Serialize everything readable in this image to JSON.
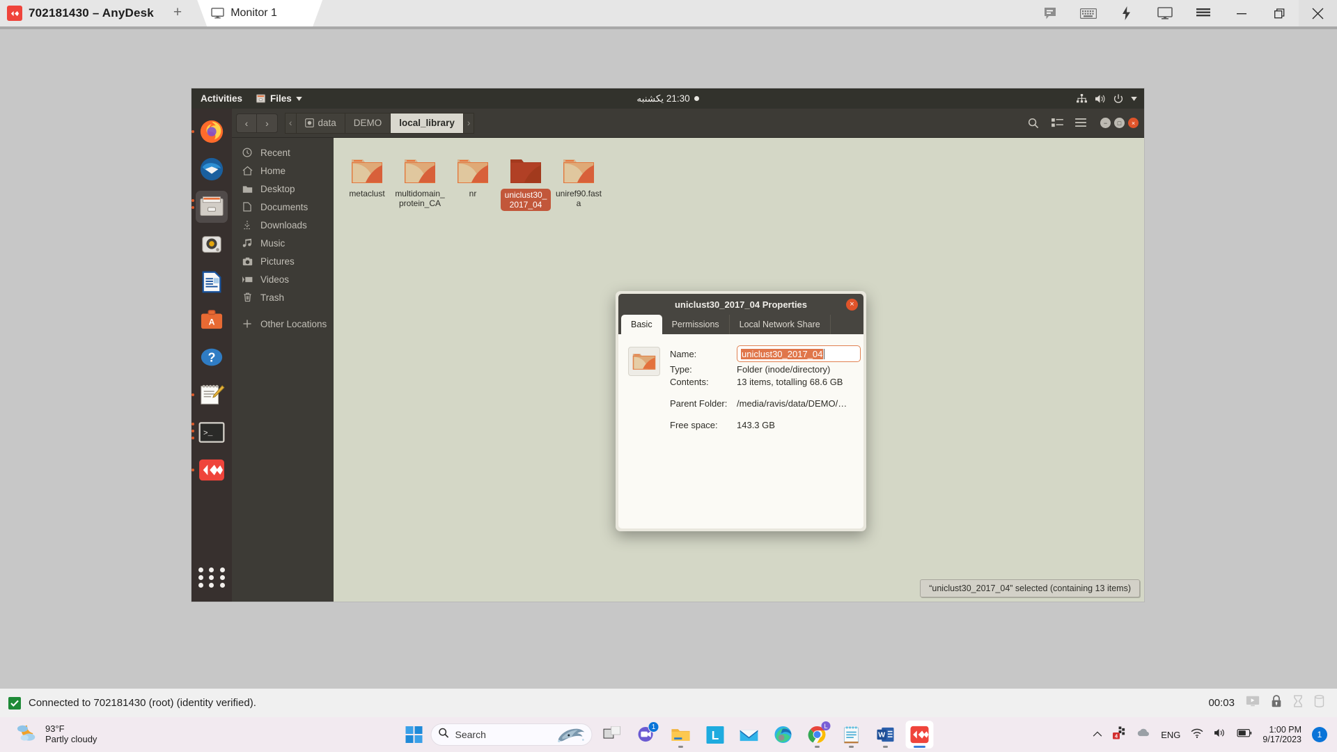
{
  "anydesk": {
    "title": "702181430 – AnyDesk",
    "new_tab_label": "+",
    "tab": {
      "label": "Monitor 1",
      "icon": "monitor-icon"
    },
    "titlebar_buttons": [
      {
        "name": "chat-icon",
        "label": ""
      },
      {
        "name": "keyboard-icon",
        "label": ""
      },
      {
        "name": "lightning-icon",
        "label": ""
      },
      {
        "name": "display-icon",
        "label": ""
      },
      {
        "name": "hamburger-menu-icon",
        "label": ""
      },
      {
        "name": "minimize-icon",
        "label": ""
      },
      {
        "name": "restore-icon",
        "label": ""
      },
      {
        "name": "close-icon",
        "label": ""
      }
    ],
    "status": {
      "text": "Connected to 702181430 (root) (identity verified).",
      "session_time": "00:03",
      "icons": [
        "screen-share-icon",
        "lock-icon",
        "hourglass-icon",
        "clipboard-icon"
      ]
    }
  },
  "gnome": {
    "activities": "Activities",
    "app_menu": "Files",
    "clock": "21:30 یکشنبه",
    "status_icons": [
      "network-icon",
      "volume-icon",
      "power-icon",
      "chevron-down-icon"
    ]
  },
  "dock": {
    "items": [
      {
        "name": "firefox",
        "running": true
      },
      {
        "name": "thunderbird",
        "running": false
      },
      {
        "name": "files",
        "running": true,
        "active": true
      },
      {
        "name": "rhythmbox",
        "running": false
      },
      {
        "name": "libreoffice-writer",
        "running": false
      },
      {
        "name": "ubuntu-software",
        "running": false
      },
      {
        "name": "help",
        "running": false
      },
      {
        "name": "text-editor",
        "running": true
      },
      {
        "name": "terminal",
        "running": true
      },
      {
        "name": "anydesk",
        "running": true
      }
    ],
    "show_apps_label": "Show Applications"
  },
  "files": {
    "nav": {
      "back": "‹",
      "forward": "›"
    },
    "breadcrumb": [
      {
        "label": "data",
        "icon": "drive-icon",
        "current": false
      },
      {
        "label": "DEMO",
        "icon": "",
        "current": false
      },
      {
        "label": "local_library",
        "icon": "",
        "current": true
      }
    ],
    "header_buttons": [
      "search-icon",
      "view-grid-icon",
      "hamburger-menu-icon"
    ],
    "window_controls": [
      "minimize",
      "maximize",
      "close"
    ],
    "sidebar": [
      {
        "label": "Recent",
        "icon": "clock-icon"
      },
      {
        "label": "Home",
        "icon": "home-icon"
      },
      {
        "label": "Desktop",
        "icon": "folder-icon"
      },
      {
        "label": "Documents",
        "icon": "document-icon"
      },
      {
        "label": "Downloads",
        "icon": "download-icon"
      },
      {
        "label": "Music",
        "icon": "music-icon"
      },
      {
        "label": "Pictures",
        "icon": "camera-icon"
      },
      {
        "label": "Videos",
        "icon": "video-icon"
      },
      {
        "label": "Trash",
        "icon": "trash-icon"
      }
    ],
    "sidebar_other": {
      "label": "Other Locations",
      "icon": "plus-icon"
    },
    "items": [
      {
        "label": "metaclust",
        "selected": false
      },
      {
        "label": "multidomain_protein_CA",
        "selected": false
      },
      {
        "label": "nr",
        "selected": false
      },
      {
        "label": "uniclust30_2017_04",
        "selected": true
      },
      {
        "label": "uniref90.fasta",
        "selected": false
      }
    ],
    "status": "“uniclust30_2017_04” selected  (containing 13 items)"
  },
  "properties": {
    "title": "uniclust30_2017_04 Properties",
    "close_label": "×",
    "tabs": [
      {
        "label": "Basic",
        "active": true
      },
      {
        "label": "Permissions",
        "active": false
      },
      {
        "label": "Local Network Share",
        "active": false
      }
    ],
    "fields": {
      "name_label": "Name:",
      "name_value": "uniclust30_2017_04",
      "type_label": "Type:",
      "type_value": "Folder (inode/directory)",
      "contents_label": "Contents:",
      "contents_value": "13 items, totalling 68.6 GB",
      "parent_label": "Parent Folder:",
      "parent_value": "/media/ravis/data/DEMO/…",
      "free_label": "Free space:",
      "free_value": "143.3 GB"
    }
  },
  "taskbar": {
    "weather": {
      "temp": "93°F",
      "desc": "Partly cloudy",
      "icon": "partly-cloudy-night-icon"
    },
    "start_label": "Start",
    "search_placeholder": "Search",
    "apps": [
      {
        "name": "task-view",
        "badge": ""
      },
      {
        "name": "microsoft-teams",
        "badge": "1"
      },
      {
        "name": "file-explorer",
        "badge": ""
      },
      {
        "name": "linkedin",
        "badge": ""
      },
      {
        "name": "mail",
        "badge": ""
      },
      {
        "name": "microsoft-edge",
        "badge": ""
      },
      {
        "name": "google-chrome",
        "badge": ""
      },
      {
        "name": "notepad",
        "badge": ""
      },
      {
        "name": "microsoft-word",
        "badge": ""
      },
      {
        "name": "anydesk",
        "badge": ""
      }
    ],
    "tray": {
      "overflow": "^",
      "language": "ENG",
      "icons": [
        "update-icon",
        "onedrive-icon",
        "wifi-icon",
        "volume-icon",
        "battery-icon"
      ],
      "time": "1:00 PM",
      "date": "9/17/2023",
      "notification_count": "1"
    }
  },
  "colors": {
    "anydesk_red": "#ef443b",
    "ubuntu_orange": "#e0542a",
    "gnome_dark": "#3d3b36",
    "desktop_bg": "#d4d7c6",
    "selection": "#c2573a",
    "taskbar_bg": "#f2eaf0",
    "accent_blue": "#0a74d8"
  }
}
